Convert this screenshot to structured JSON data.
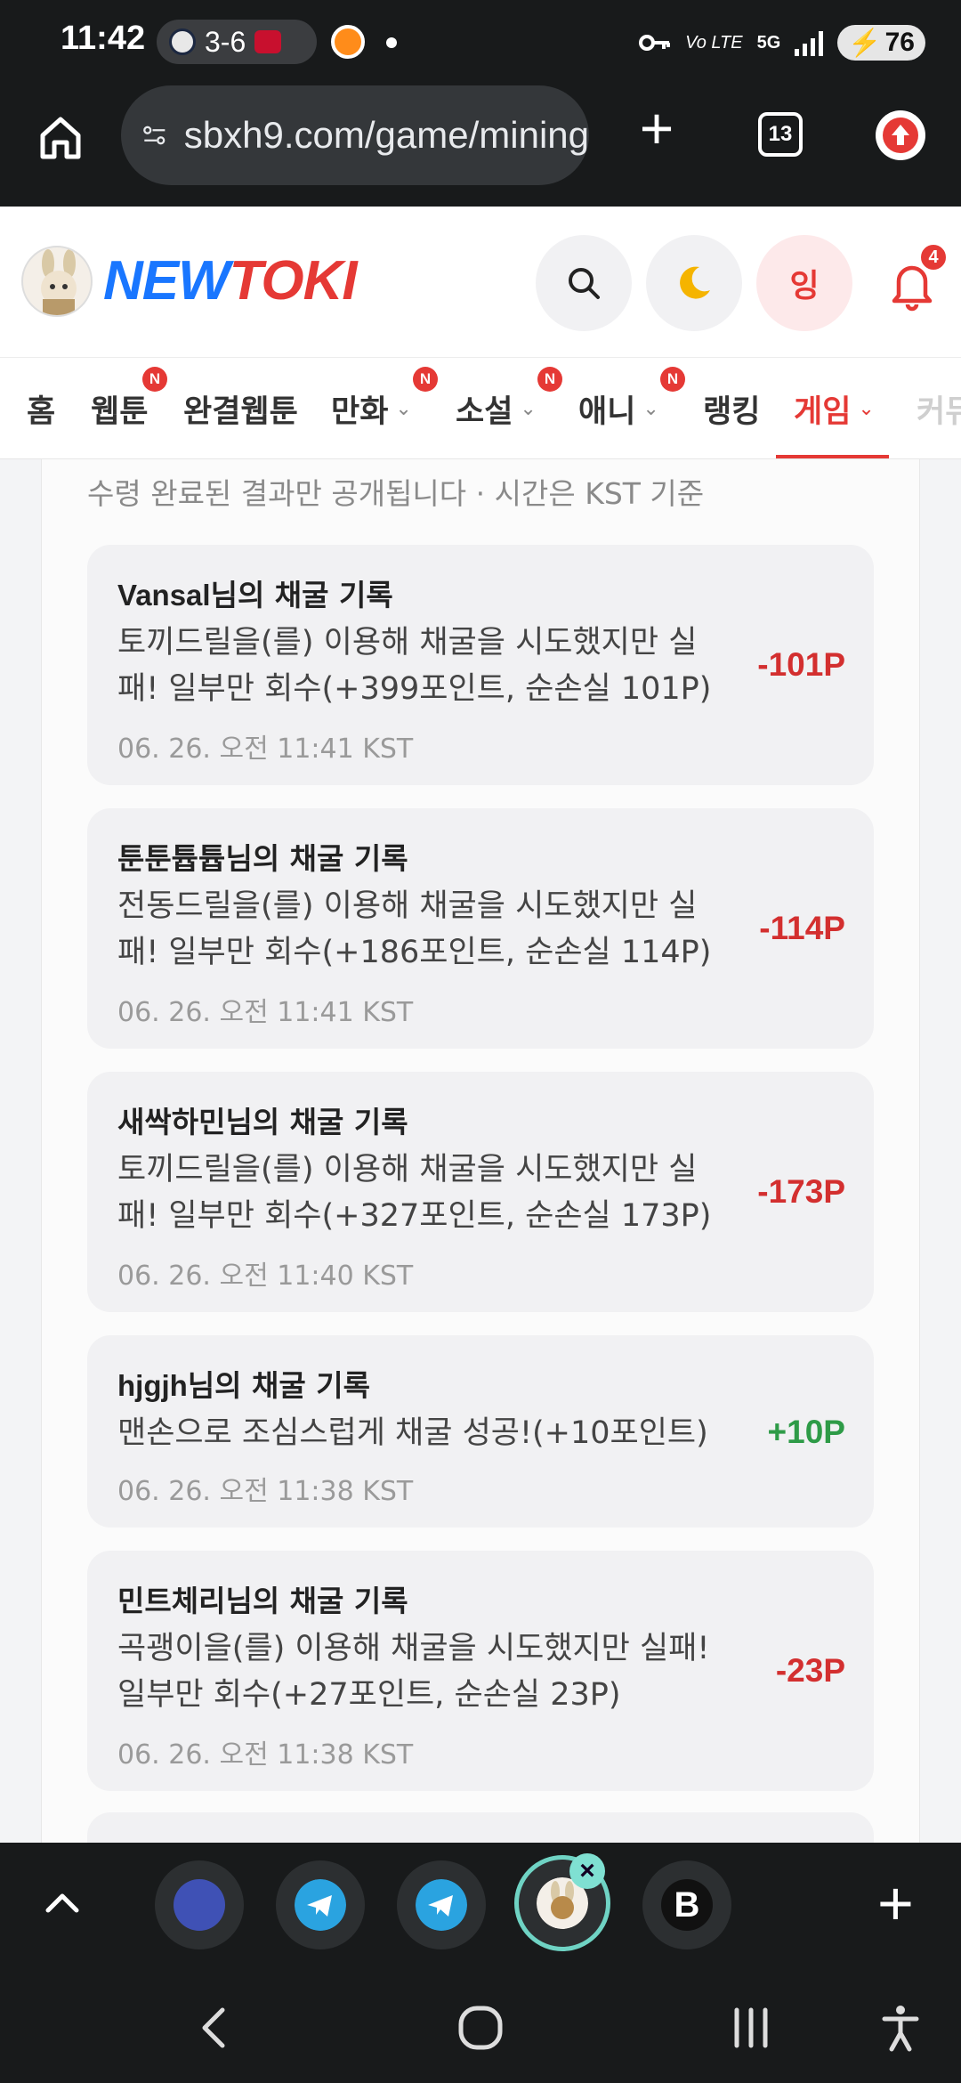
{
  "status_bar": {
    "time": "11:42",
    "score": "3-6",
    "volte": "Vo LTE",
    "network": "5G",
    "battery": "76"
  },
  "browser": {
    "url": "sbxh9.com/game/mining",
    "tab_count": "13"
  },
  "header": {
    "logo_new": "NEW",
    "logo_toki": "TOKI",
    "user_initial": "잉",
    "notification_count": "4"
  },
  "nav": {
    "items": [
      {
        "label": "홈"
      },
      {
        "label": "웹툰",
        "badge": "N"
      },
      {
        "label": "완결웹툰"
      },
      {
        "label": "만화",
        "badge": "N"
      },
      {
        "label": "소설",
        "badge": "N"
      },
      {
        "label": "애니",
        "badge": "N"
      },
      {
        "label": "랭킹"
      },
      {
        "label": "게임"
      },
      {
        "label": "커뮤"
      }
    ]
  },
  "notice": "수령 완료된 결과만 공개됩니다 · 시간은 KST 기준",
  "records": [
    {
      "user": "Vansal",
      "suffix": "님의 채굴 기록",
      "desc": "토끼드릴을(를) 이용해 채굴을 시도했지만 실패! 일부만 회수(+399포인트, 순손실 101P)",
      "time": "06. 26. 오전 11:41 KST",
      "amount": "-101P"
    },
    {
      "user": "툰툰튭튭",
      "suffix": "님의 채굴 기록",
      "desc": "전동드릴을(를) 이용해 채굴을 시도했지만 실패! 일부만 회수(+186포인트, 순손실 114P)",
      "time": "06. 26. 오전 11:41 KST",
      "amount": "-114P"
    },
    {
      "user": "새싹하민",
      "suffix": "님의 채굴 기록",
      "desc": "토끼드릴을(를) 이용해 채굴을 시도했지만 실패! 일부만 회수(+327포인트, 순손실 173P)",
      "time": "06. 26. 오전 11:40 KST",
      "amount": "-173P"
    },
    {
      "user": "hjgjh",
      "suffix": "님의 채굴 기록",
      "desc": "맨손으로 조심스럽게 채굴 성공!(+10포인트)",
      "time": "06. 26. 오전 11:38 KST",
      "amount": "+10P"
    },
    {
      "user": "민트체리",
      "suffix": "님의 채굴 기록",
      "desc": "곡괭이을(를) 이용해 채굴을 시도했지만 실패! 일부만 회수(+27포인트, 순손실 23P)",
      "time": "06. 26. 오전 11:38 KST",
      "amount": "-23P"
    }
  ],
  "dock": {
    "apps": [
      "app-1",
      "telegram",
      "telegram",
      "newtoki",
      "b-app"
    ]
  }
}
